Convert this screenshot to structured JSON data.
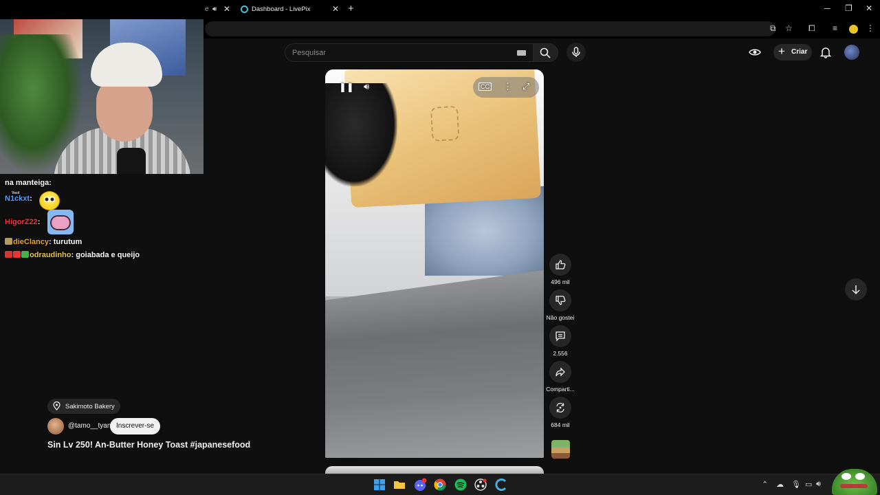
{
  "browser": {
    "tabs": [
      {
        "label": "e",
        "active": false
      },
      {
        "label": "Dashboard - LivePix",
        "active": true
      }
    ],
    "new_tab_icon": "+"
  },
  "masthead": {
    "search_placeholder": "Pesquisar",
    "create_label": "Criar"
  },
  "chat": {
    "you_label": "Você",
    "lines": [
      {
        "user": "",
        "text": "na manteiga:"
      },
      {
        "user": "N1ckxt",
        "text": ":",
        "user_color": "#5aa0ff",
        "emote": "smiley-face"
      },
      {
        "user": "HigorZ22",
        "text": ":",
        "user_color": "#ff3333",
        "emote": "pink-creature"
      },
      {
        "user": "dieClancy",
        "text": ": turutum",
        "user_color": "#e8a431"
      },
      {
        "user": "odraudinho",
        "text": ":  goiabada e queijo",
        "user_color": "#e8c84a"
      }
    ]
  },
  "short": {
    "location": "Sakimoto Bakery",
    "channel": "@tamo__tyan",
    "subscribe_label": "Inscrever-se",
    "title": "Sin Lv 250! An-Butter Honey Toast #japanesefood"
  },
  "actions": {
    "likes": "496 mil",
    "dislike": "Não gostei",
    "comments": "2.556",
    "share": "Comparti...",
    "remix": "684 mil"
  },
  "colors": {
    "background": "#0f0f0f",
    "chip": "#272727",
    "subscribe_bg": "#f1f1f1"
  }
}
